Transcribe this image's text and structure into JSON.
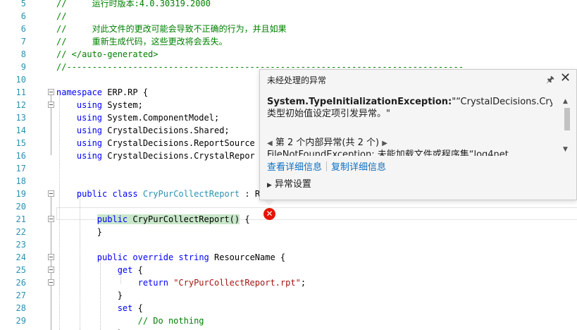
{
  "editor": {
    "lines": [
      {
        "num": "5",
        "tokens": [
          {
            "c": "cm",
            "t": "//     运行时版本:4.0.30319.2000"
          }
        ]
      },
      {
        "num": "6",
        "tokens": [
          {
            "c": "cm",
            "t": "//"
          }
        ]
      },
      {
        "num": "6",
        "tokens": [
          {
            "c": "cm",
            "t": "//     对此文件的更改可能会导致不正确的行为，并且如果"
          }
        ]
      },
      {
        "num": "7",
        "tokens": [
          {
            "c": "cm",
            "t": "//     重新生成代码，这些更改将会丢失。"
          }
        ]
      },
      {
        "num": "8",
        "tokens": [
          {
            "c": "cm",
            "t": "// </auto-generated>"
          }
        ]
      },
      {
        "num": "9",
        "tokens": [
          {
            "c": "cm",
            "t": "//------------------------------------------------------------------------------"
          }
        ]
      },
      {
        "num": "10",
        "tokens": []
      },
      {
        "num": "11",
        "tokens": [
          {
            "c": "kw",
            "t": "namespace"
          },
          {
            "c": "",
            "t": " ERP.RP {"
          }
        ]
      },
      {
        "num": "12",
        "tokens": [
          {
            "c": "",
            "t": "    "
          },
          {
            "c": "kw",
            "t": "using"
          },
          {
            "c": "",
            "t": " System;"
          }
        ]
      },
      {
        "num": "13",
        "tokens": [
          {
            "c": "",
            "t": "    "
          },
          {
            "c": "kw",
            "t": "using"
          },
          {
            "c": "",
            "t": " System.ComponentModel;"
          }
        ]
      },
      {
        "num": "14",
        "tokens": [
          {
            "c": "",
            "t": "    "
          },
          {
            "c": "kw",
            "t": "using"
          },
          {
            "c": "",
            "t": " CrystalDecisions.Shared;"
          }
        ]
      },
      {
        "num": "15",
        "tokens": [
          {
            "c": "",
            "t": "    "
          },
          {
            "c": "kw",
            "t": "using"
          },
          {
            "c": "",
            "t": " CrystalDecisions.ReportSource"
          }
        ]
      },
      {
        "num": "16",
        "tokens": [
          {
            "c": "",
            "t": "    "
          },
          {
            "c": "kw",
            "t": "using"
          },
          {
            "c": "",
            "t": " CrystalDecisions.CrystalRepor"
          }
        ]
      },
      {
        "num": "17",
        "tokens": []
      },
      {
        "num": "18",
        "tokens": []
      },
      {
        "num": "19",
        "tokens": [
          {
            "c": "",
            "t": "    "
          },
          {
            "c": "kw",
            "t": "public"
          },
          {
            "c": "",
            "t": " "
          },
          {
            "c": "kw",
            "t": "class"
          },
          {
            "c": "",
            "t": " "
          },
          {
            "c": "ty",
            "t": "CryPurCollectReport"
          },
          {
            "c": "",
            "t": " : R"
          }
        ]
      },
      {
        "num": "20",
        "tokens": []
      },
      {
        "num": "21",
        "tokens": [
          {
            "c": "",
            "t": "        "
          },
          {
            "c": "kw hl",
            "t": "public"
          },
          {
            "c": "hl",
            "t": " CryPurCollectReport()"
          },
          {
            "c": "",
            "t": " {"
          }
        ]
      },
      {
        "num": "22",
        "tokens": [
          {
            "c": "",
            "t": "        }"
          }
        ]
      },
      {
        "num": "23",
        "tokens": []
      },
      {
        "num": "24",
        "tokens": [
          {
            "c": "",
            "t": "        "
          },
          {
            "c": "kw",
            "t": "public"
          },
          {
            "c": "",
            "t": " "
          },
          {
            "c": "kw",
            "t": "override"
          },
          {
            "c": "",
            "t": " "
          },
          {
            "c": "kw",
            "t": "string"
          },
          {
            "c": "",
            "t": " ResourceName {"
          }
        ]
      },
      {
        "num": "25",
        "tokens": [
          {
            "c": "",
            "t": "            "
          },
          {
            "c": "kw",
            "t": "get"
          },
          {
            "c": "",
            "t": " {"
          }
        ]
      },
      {
        "num": "26",
        "tokens": [
          {
            "c": "",
            "t": "                "
          },
          {
            "c": "kw",
            "t": "return"
          },
          {
            "c": "",
            "t": " "
          },
          {
            "c": "st",
            "t": "\"CryPurCollectReport.rpt\""
          },
          {
            "c": "",
            "t": ";"
          }
        ]
      },
      {
        "num": "27",
        "tokens": [
          {
            "c": "",
            "t": "            }"
          }
        ]
      },
      {
        "num": "28",
        "tokens": [
          {
            "c": "",
            "t": "            "
          },
          {
            "c": "kw",
            "t": "set"
          },
          {
            "c": "",
            "t": " {"
          }
        ]
      },
      {
        "num": "29",
        "tokens": [
          {
            "c": "",
            "t": "                "
          },
          {
            "c": "cm",
            "t": "// Do nothing"
          }
        ]
      },
      {
        "num": "30",
        "tokens": [
          {
            "c": "",
            "t": "            }"
          }
        ]
      }
    ]
  },
  "popup": {
    "title": "未经处理的异常",
    "exception_type": "System.TypeInitializationException:",
    "exception_message": "\"“CrystalDecisions.CrystalReports.Engine.ReportDocument”的类型初始值设定项引发异常。\"",
    "inner_nav": "第 2 个内部异常(共 2 个)",
    "inner_detail": "FileNotFoundException: 未能加载文件或程序集“log4net",
    "link_view_details": "查看详细信息",
    "link_copy_details": "复制详细信息",
    "exception_settings": "异常设置",
    "icons": {
      "pin": "pin-icon",
      "close": "close-icon",
      "error": "error-icon"
    }
  }
}
